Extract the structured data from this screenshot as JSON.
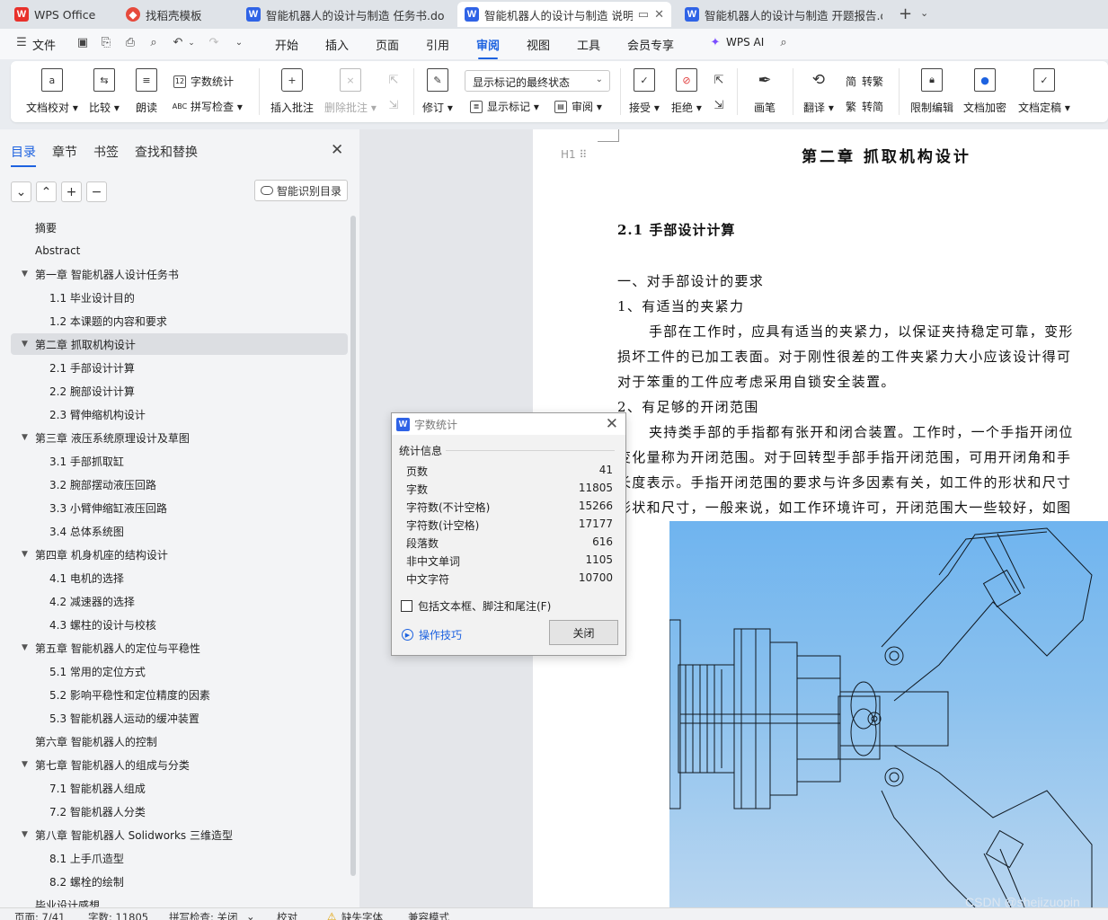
{
  "tabs": [
    {
      "label": "WPS Office",
      "icon": "wps-logo-icon"
    },
    {
      "label": "找稻壳模板",
      "icon": "docer-shell-icon"
    },
    {
      "label": "智能机器人的设计与制造 任务书.docx",
      "icon": "word-doc-icon"
    },
    {
      "label": "智能机器人的设计与制造 说明",
      "icon": "word-doc-icon",
      "active": true
    },
    {
      "label": "智能机器人的设计与制造 开题报告.do",
      "icon": "word-doc-icon"
    }
  ],
  "menu": {
    "file": "文件",
    "items": [
      "开始",
      "插入",
      "页面",
      "引用",
      "审阅",
      "视图",
      "工具",
      "会员专享"
    ],
    "active": "审阅",
    "wps_ai": "WPS AI"
  },
  "ribbon": {
    "doc_proofread": "文档校对",
    "compare": "比较",
    "read_aloud": "朗读",
    "word_count": "字数统计",
    "spell_check": "拼写检查",
    "insert_comment": "插入批注",
    "delete_comment": "删除批注",
    "track_changes": "修订",
    "markup_state": "显示标记的最终状态",
    "show_markup": "显示标记",
    "review": "审阅",
    "accept": "接受",
    "reject": "拒绝",
    "pen": "画笔",
    "translate": "翻译",
    "to_traditional": "转繁",
    "to_simplified": "转简",
    "restrict_edit": "限制编辑",
    "encrypt": "文档加密",
    "finalize": "文档定稿"
  },
  "nav": {
    "tabs": [
      "目录",
      "章节",
      "书签",
      "查找和替换"
    ],
    "smart_toc": "智能识别目录",
    "toc": [
      {
        "label": "摘要",
        "level": 1
      },
      {
        "label": "Abstract",
        "level": 1
      },
      {
        "label": "第一章  智能机器人设计任务书",
        "level": 1,
        "toggle": true
      },
      {
        "label": "1.1 毕业设计目的",
        "level": 2
      },
      {
        "label": "1.2 本课题的内容和要求",
        "level": 2
      },
      {
        "label": "第二章  抓取机构设计",
        "level": 1,
        "toggle": true,
        "selected": true
      },
      {
        "label": "2.1 手部设计计算",
        "level": 2
      },
      {
        "label": "2.2 腕部设计计算",
        "level": 2
      },
      {
        "label": "2.3 臂伸缩机构设计",
        "level": 2
      },
      {
        "label": "第三章  液压系统原理设计及草图",
        "level": 1,
        "toggle": true
      },
      {
        "label": "3.1 手部抓取缸",
        "level": 2
      },
      {
        "label": "3.2 腕部摆动液压回路",
        "level": 2
      },
      {
        "label": "3.3 小臂伸缩缸液压回路",
        "level": 2
      },
      {
        "label": "3.4 总体系统图",
        "level": 2
      },
      {
        "label": "第四章  机身机座的结构设计",
        "level": 1,
        "toggle": true
      },
      {
        "label": "4.1 电机的选择",
        "level": 2
      },
      {
        "label": "4.2 减速器的选择",
        "level": 2
      },
      {
        "label": "4.3 螺柱的设计与校核",
        "level": 2
      },
      {
        "label": "第五章  智能机器人的定位与平稳性",
        "level": 1,
        "toggle": true
      },
      {
        "label": "5.1 常用的定位方式",
        "level": 2
      },
      {
        "label": "5.2 影响平稳性和定位精度的因素",
        "level": 2
      },
      {
        "label": "5.3 智能机器人运动的缓冲装置",
        "level": 2
      },
      {
        "label": "第六章  智能机器人的控制",
        "level": 1
      },
      {
        "label": "第七章  智能机器人的组成与分类",
        "level": 1,
        "toggle": true
      },
      {
        "label": "7.1 智能机器人组成",
        "level": 2
      },
      {
        "label": "7.2 智能机器人分类",
        "level": 2
      },
      {
        "label": "第八章  智能机器人 Solidworks 三维造型",
        "level": 1,
        "toggle": true
      },
      {
        "label": "8.1 上手爪造型",
        "level": 2
      },
      {
        "label": "8.2 螺栓的绘制",
        "level": 2
      },
      {
        "label": "毕业设计感想",
        "level": 1
      }
    ]
  },
  "document": {
    "heading_handle": "H1 ⠿",
    "chapter_title": "第二章  抓取机构设计",
    "section_title": "2.1 手部设计计算",
    "lines": [
      "一、对手部设计的要求",
      "1、有适当的夹紧力",
      "手部在工作时，应具有适当的夹紧力，以保证夹持稳定可靠，变形",
      "损坏工件的已加工表面。对于刚性很差的工件夹紧力大小应该设计得可",
      "对于笨重的工件应考虑采用自锁安全装置。",
      "2、有足够的开闭范围",
      "夹持类手部的手指都有张开和闭合装置。工作时，一个手指开闭位",
      "变化量称为开闭范围。对于回转型手部手指开闭范围，可用开闭角和手",
      "长度表示。手指开闭范围的要求与许多因素有关，如工件的形状和尺寸",
      "形状和尺寸，一般来说，如工作环境许可，开闭范围大一些较好，如图"
    ],
    "watermark": "CSDN @shejizuopin"
  },
  "dialog": {
    "title": "字数统计",
    "group_label": "统计信息",
    "stats": [
      {
        "label": "页数",
        "value": "41"
      },
      {
        "label": "字数",
        "value": "11805"
      },
      {
        "label": "字符数(不计空格)",
        "value": "15266"
      },
      {
        "label": "字符数(计空格)",
        "value": "17177"
      },
      {
        "label": "段落数",
        "value": "616"
      },
      {
        "label": "非中文单词",
        "value": "1105"
      },
      {
        "label": "中文字符",
        "value": "10700"
      }
    ],
    "include_checkbox": "包括文本框、脚注和尾注(F)",
    "tips_link": "操作技巧",
    "close_button": "关闭"
  },
  "status": {
    "page": "页面: 7/41",
    "words": "字数: 11805",
    "spell": "拼写检查: 关闭",
    "proof": "校对",
    "missing_font": "缺失字体",
    "compat": "兼容模式"
  },
  "colors": {
    "accent": "#1d62e0",
    "figure_bg": "#6fb4ef",
    "word_icon": "#2f63e6",
    "wps_logo": "#e8312b"
  }
}
